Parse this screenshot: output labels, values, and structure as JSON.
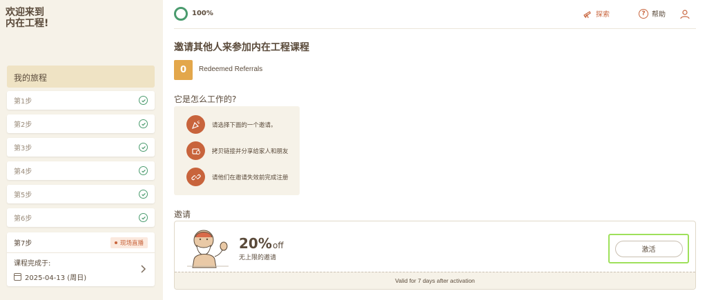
{
  "sidebar": {
    "welcome": "欢迎来到\n内在工程!",
    "journey_header": "我的旅程",
    "steps": [
      {
        "label": "第1步",
        "done": true
      },
      {
        "label": "第2步",
        "done": true
      },
      {
        "label": "第3步",
        "done": true
      },
      {
        "label": "第4步",
        "done": true
      },
      {
        "label": "第5步",
        "done": true
      },
      {
        "label": "第6步",
        "done": true
      }
    ],
    "step7": {
      "label": "第7步",
      "badge": "现场直播",
      "complete_label": "课程完成于:",
      "date": "2025-04-13 (周日)"
    }
  },
  "topbar": {
    "progress": "100%",
    "explore": "探索",
    "help": "帮助"
  },
  "main": {
    "title": "邀请其他人来参加内在工程课程",
    "referral_count": "0",
    "referral_label": "Redeemed Referrals",
    "how_title": "它是怎么工作的?",
    "how_steps": [
      "请选择下面的一个邀请。",
      "拷贝链接并分享给家人和朋友",
      "请他们在邀请失效前完成注册"
    ],
    "invite_title": "邀请",
    "invite": {
      "percent": "20%",
      "off": "off",
      "subtitle": "无上限的邀请",
      "button": "激活",
      "validity": "Valid for 7 days after activation"
    }
  },
  "colors": {
    "accent_orange": "#c8643c",
    "success_green": "#4a9b6e",
    "referral_box": "#e3a74b",
    "highlight": "#9ee05a"
  }
}
